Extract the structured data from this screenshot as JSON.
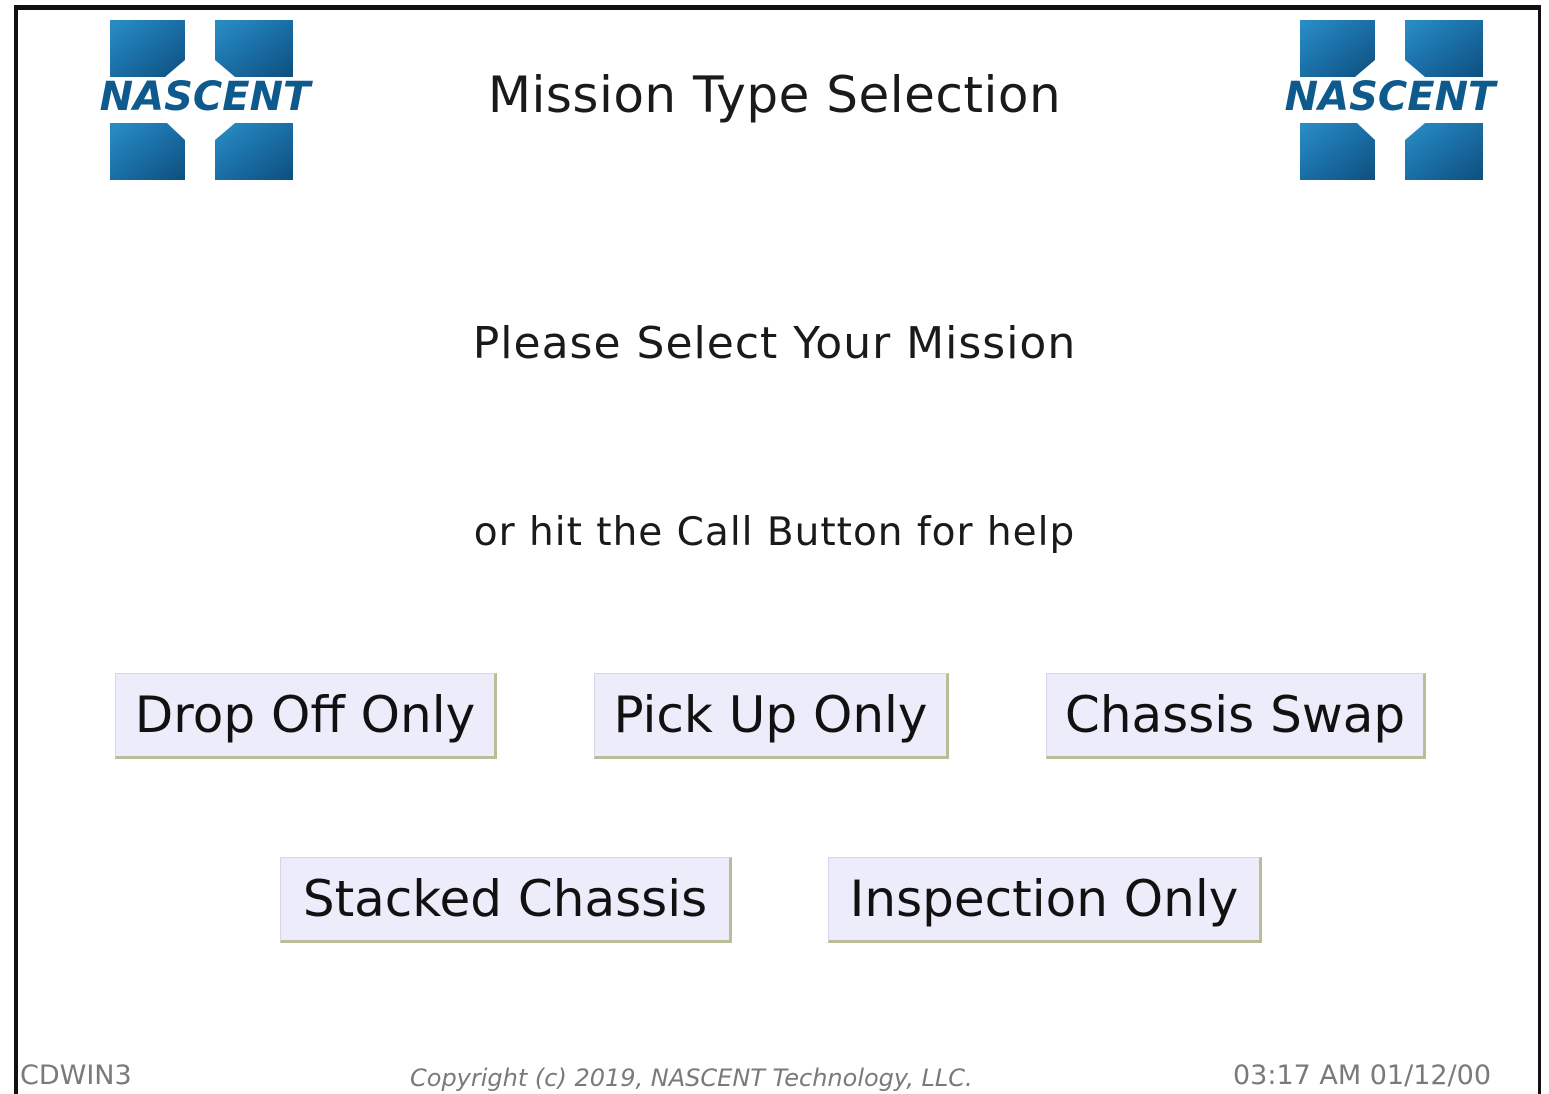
{
  "header": {
    "title": "Mission Type Selection",
    "logo_text": "NASCENT"
  },
  "main": {
    "prompt": "Please Select Your Mission",
    "help_text": "or hit the Call Button for help"
  },
  "missions": {
    "drop_off": "Drop Off Only",
    "pick_up": "Pick Up Only",
    "chassis_swap": "Chassis Swap",
    "stacked_chassis": "Stacked Chassis",
    "inspection": "Inspection Only"
  },
  "footer": {
    "station": "CDWIN3",
    "copyright": "Copyright (c) 2019, NASCENT Technology, LLC.",
    "datetime": "03:17 AM 01/12/00"
  },
  "colors": {
    "button_bg": "#ececfb",
    "logo_blue": "#1d6fa8",
    "logo_text": "#0f5a8c"
  }
}
